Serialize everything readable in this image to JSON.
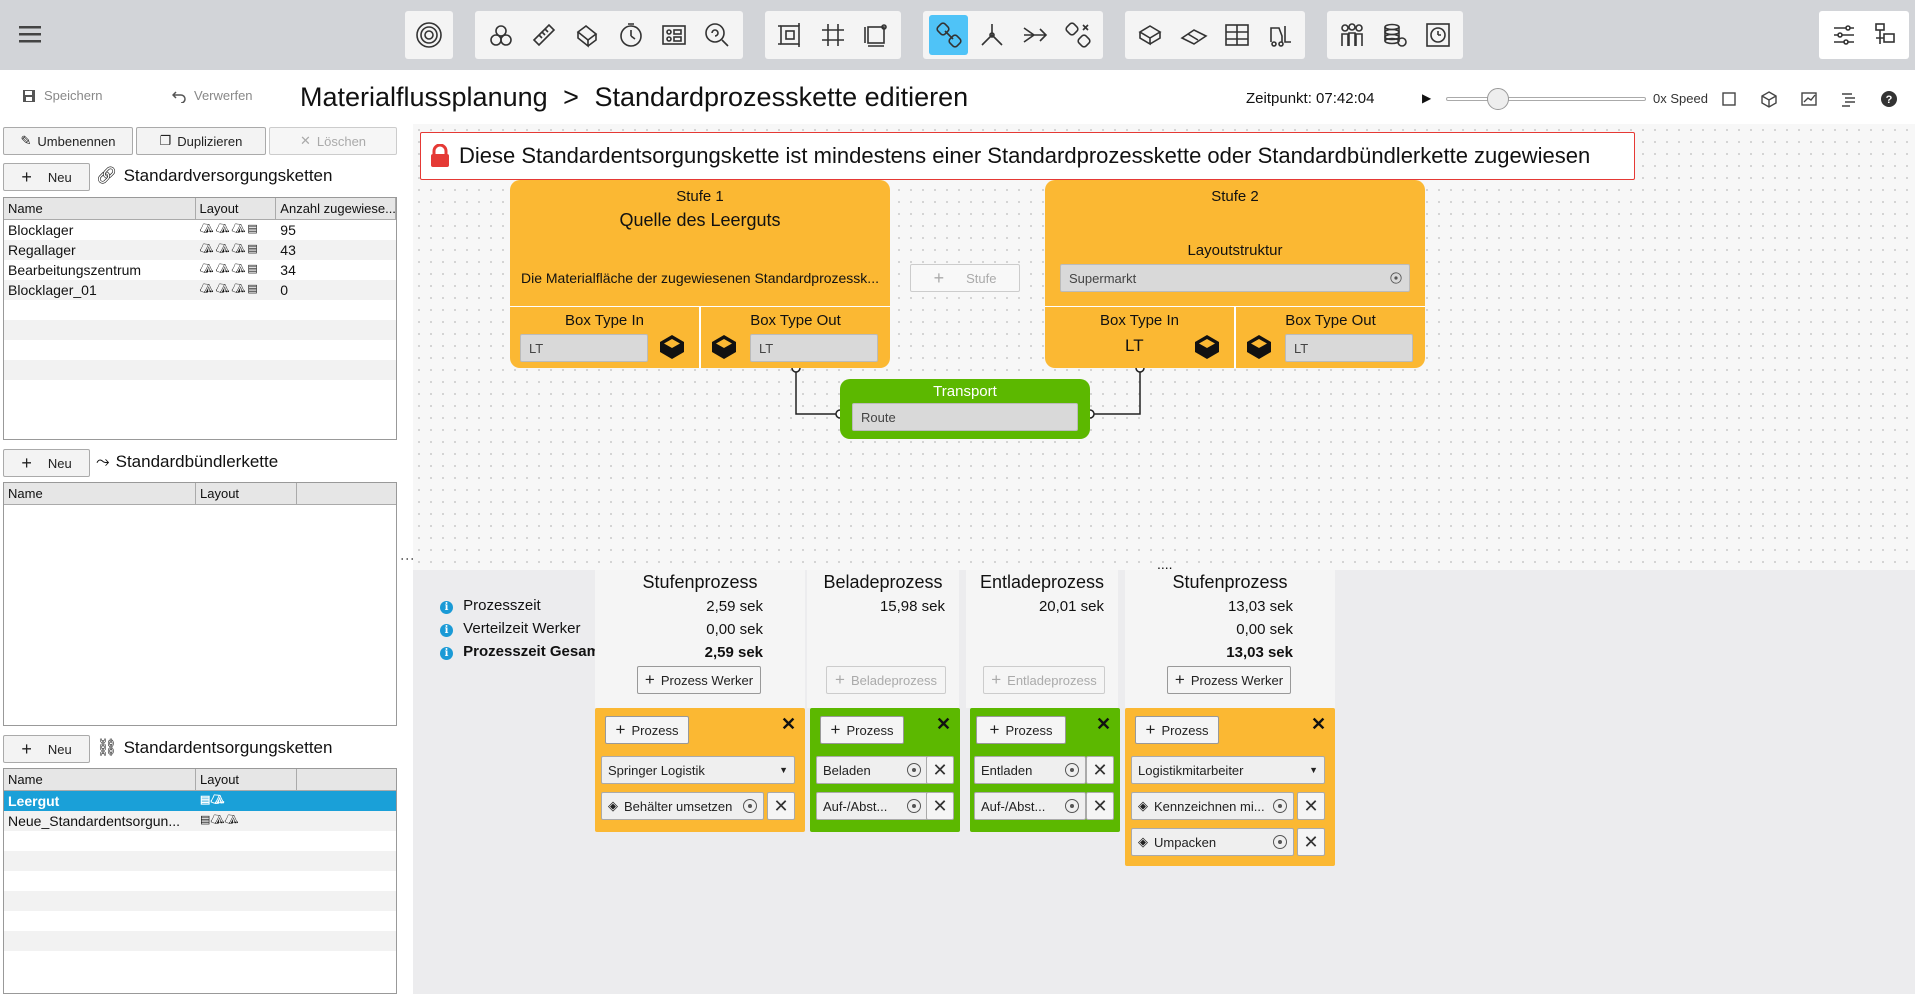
{
  "header": {
    "save_label": "Speichern",
    "discard_label": "Verwerfen",
    "breadcrumb_root": "Materialflussplanung",
    "breadcrumb_sep": ">",
    "breadcrumb_page": "Standardprozesskette editieren",
    "time_label": "Zeitpunkt: 07:42:04",
    "speed_label": "0x Speed"
  },
  "toolbar_groups": [
    [
      "spiral-icon"
    ],
    [
      "parts-icon",
      "ruler-icon",
      "box-tilt-icon",
      "stopwatch-icon",
      "grid-panel-icon",
      "search-cycle-icon"
    ],
    [
      "frame-icon",
      "grid-icon",
      "frame-dim-icon"
    ],
    [
      "chain-link-icon",
      "fork-icon",
      "merge-arrow-icon",
      "chain-remove-icon"
    ],
    [
      "truck-box-icon",
      "conveyor-icon",
      "rack-icon",
      "forklift-icon"
    ],
    [
      "workers-icon",
      "coins-icon",
      "clock-frame-icon"
    ]
  ],
  "sidebar": {
    "rename_label": "Umbenennen",
    "duplicate_label": "Duplizieren",
    "delete_label": "Löschen",
    "new_label": "Neu",
    "supply": {
      "title": "Standardversorgungsketten",
      "columns": [
        "Name",
        "Layout",
        "Anzahl zugewiese..."
      ],
      "rows": [
        {
          "name": "Blocklager",
          "count": "95"
        },
        {
          "name": "Regallager",
          "count": "43"
        },
        {
          "name": "Bearbeitungszentrum",
          "count": "34"
        },
        {
          "name": "Blocklager_01",
          "count": "0"
        }
      ]
    },
    "bundler": {
      "title": "Standardbündlerkette",
      "columns": [
        "Name",
        "Layout"
      ]
    },
    "disposal": {
      "title": "Standardentsorgungsketten",
      "columns": [
        "Name",
        "Layout"
      ],
      "rows": [
        {
          "name": "Leergut"
        },
        {
          "name": "Neue_Standardentsorgun..."
        }
      ]
    }
  },
  "warning": "Diese Standardentsorgungskette ist mindestens einer Standardprozesskette oder Standardbündlerkette zugewiesen",
  "stage1": {
    "label": "Stufe 1",
    "name": "Quelle des Leerguts",
    "description": "Die Materialfläche der zugewiesenen Standardprozessk...",
    "box_in_label": "Box Type In",
    "box_in_value": "LT",
    "box_out_label": "Box Type Out",
    "box_out_value": "LT"
  },
  "add_stage_label": "Stufe",
  "stage2": {
    "label": "Stufe 2",
    "layout_label": "Layoutstruktur",
    "layout_value": "Supermarkt",
    "box_in_label": "Box Type In",
    "box_in_value": "LT",
    "box_out_label": "Box Type Out",
    "box_out_value": "LT"
  },
  "transport": {
    "label": "Transport",
    "value": "Route"
  },
  "stats": {
    "labels": [
      "Prozesszeit",
      "Verteilzeit Werker",
      "Prozesszeit Gesamt"
    ],
    "ellipsis": "....",
    "columns": [
      {
        "title": "Stufenprozess",
        "v1": "2,59 sek",
        "v2": "0,00 sek",
        "total": "2,59 sek",
        "button": "Prozess Werker"
      },
      {
        "title": "Beladeprozess",
        "v1": "15,98 sek",
        "button": "Beladeprozess"
      },
      {
        "title": "Entladeprozess",
        "v1": "20,01 sek",
        "button": "Entladeprozess"
      },
      {
        "title": "Stufenprozess",
        "v1": "13,03 sek",
        "v2": "0,00 sek",
        "total": "13,03 sek",
        "button": "Prozess Werker"
      }
    ]
  },
  "processes": {
    "add_label": "Prozess",
    "p1": {
      "company": "Springer Logistik",
      "step": "Behälter umsetzen"
    },
    "p2": {
      "step1": "Beladen",
      "step2": "Auf-/Abst..."
    },
    "p3": {
      "step1": "Entladen",
      "step2": "Auf-/Abst..."
    },
    "p4": {
      "worker": "Logistikmitarbeiter",
      "step1": "Kennzeichnen mi...",
      "step2": "Umpacken"
    }
  },
  "colors": {
    "stage": "#fbb833",
    "transport": "#5cb800",
    "selected": "#1aa0d8",
    "active_tool": "#4fc3f7",
    "warning": "#e53935"
  }
}
